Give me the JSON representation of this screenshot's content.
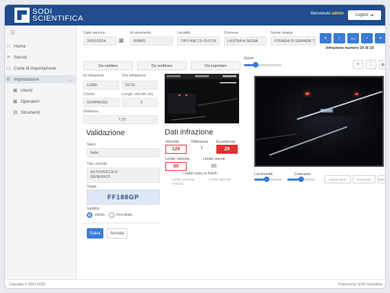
{
  "header": {
    "logo_line1": "SODI",
    "logo_line2": "SCIENTIFICA",
    "welcome_prefix": "Benvenuto",
    "user": "admin",
    "logout_label": "Logout",
    "logout_icon": "arrow-right-icon"
  },
  "sidebar": {
    "toggle_icon": "hamburger-icon",
    "items": [
      {
        "label": "Home",
        "icon": "home-icon"
      },
      {
        "label": "Servizi",
        "icon": "services-icon"
      },
      {
        "label": "Coda di importazione",
        "icon": "queue-icon"
      },
      {
        "label": "Impostazioni",
        "icon": "gear-icon"
      },
      {
        "label": "Utenti",
        "icon": "user-icon"
      },
      {
        "label": "Operatori",
        "icon": "operator-icon"
      },
      {
        "label": "Strumenti",
        "icon": "tools-icon"
      }
    ]
  },
  "info": {
    "data_servizio_label": "Data servizio",
    "data_servizio_value": "20/01/2024",
    "id_strumento_label": "Id strumento",
    "id_strumento_value": "B0B80",
    "localita_label": "Località",
    "localita_value": "TIPO KM 12+310 DX",
    "comune_label": "Comune",
    "comune_value": "LASTRA A SIGNA",
    "nome_strada_label": "Nome strada",
    "nome_strada_value": "STRADA DI GRANDE T",
    "counter_text": "Infrazione numero 10 di 10"
  },
  "actions": {
    "da_validare": "Da validare",
    "da_verificare": "Da verificare",
    "da_esportare": "Da esportare"
  },
  "details": {
    "id_infrazione_label": "Id infrazione",
    "id_infrazione_value": "11680",
    "ora_label": "Ora infrazione",
    "ora_value": "22:26",
    "corsia_label": "Corsia",
    "corsia_value": "SORPASSO",
    "lunghezza_label": "Lungh. veicolo (m)",
    "lunghezza_value": "3",
    "distanza_label": "Distanza",
    "distanza_value": "7,70"
  },
  "validazione": {
    "title": "Validazione",
    "stato_label": "Stato",
    "stato_value": "Italia",
    "tipo_label": "Tipo veicolo",
    "tipo_value_line1": "AUTOVEICOLO",
    "tipo_value_line2": "GENERICO",
    "targa_label": "Targa",
    "targa_value": "FF188GP",
    "validita_label": "Validità",
    "option_valido": "Valido",
    "option_annullata": "Annullata",
    "salva_label": "Salva",
    "annulla_label": "Annulla"
  },
  "dati": {
    "title": "Dati infrazione",
    "velocita_label": "Velocità",
    "velocita_value": "126",
    "tolleranza_label": "Tolleranza",
    "tolleranza_value": "7",
    "eccedenza_label": "Eccedenza",
    "eccedenza_value": "29",
    "limite_label": "Limite velocità",
    "limite_value": "90",
    "limite_veicoli_label": "Limite veicoli",
    "limite_veicoli_value": "90",
    "note_valori": "I valori sono in Km/h",
    "grey_note1": "Limite velocità",
    "grey_note1b": "(mezzi)",
    "grey_note2": "Limite velocità"
  },
  "viewer": {
    "zoom_label": "Zoom",
    "zoom_level": 0.3,
    "luminosita_label": "Luminosità",
    "luminosita_level": 0.45,
    "contrasto_label": "Contrasto",
    "contrasto_level": 0.5,
    "btn_reset": "Reset colore",
    "btn_rotate": "Ruota foto",
    "btn_salva": "Salva",
    "icon_target": "target-icon",
    "icon_expand": "expand-icon",
    "icon_crosshair": "crosshair-icon"
  },
  "footer": {
    "left": "Copyright © 2024 SODI",
    "right": "Powered by SODI Scientifica"
  },
  "colors": {
    "header": "#1f4c8e",
    "accent": "#3a7bd5",
    "danger": "#e03131"
  }
}
